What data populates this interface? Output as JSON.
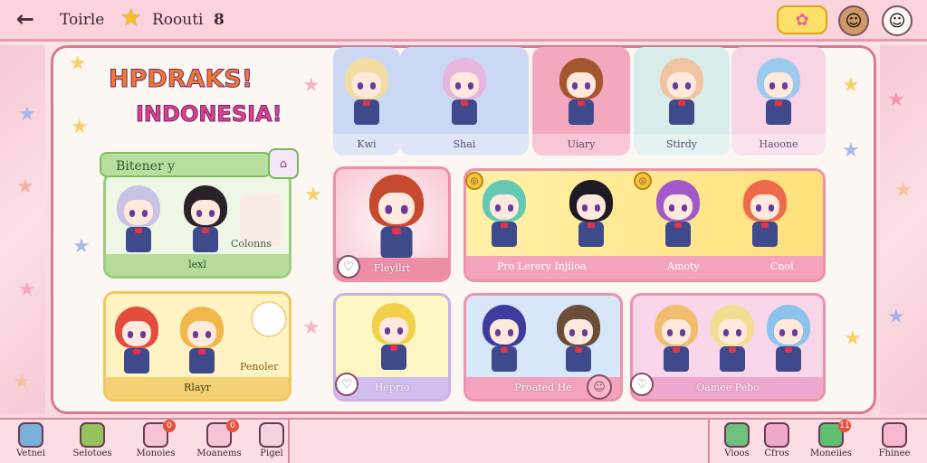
{
  "top_bar": {
    "back_label": "←",
    "tab1": "Toirle",
    "tab2": "Roouti",
    "tab2_badge": "8"
  },
  "logo": {
    "line1": "HPDRAKS!",
    "line2": "INDONESIA!"
  },
  "top_row": {
    "cards": [
      {
        "label": "Kwi",
        "hair": "#f3dca0",
        "bg": "#cbd8f3"
      },
      {
        "label": "Shai",
        "hair": "#e7b6dc",
        "bg": "#cbd8f3"
      },
      {
        "label": "Uiary",
        "hair": "#a5562e",
        "bg": "#f4a8bd"
      },
      {
        "label": "Stirdy",
        "hair": "#f1c3a0",
        "bg": "#d8ecec"
      },
      {
        "label": "Haoone",
        "hair": "#9cc9ee",
        "bg": "#f7d4e6"
      }
    ]
  },
  "group1": {
    "tag": "Bitener y",
    "label": "lexl",
    "side_label": "Colonns",
    "chars": [
      {
        "hair": "#c8c3e5"
      },
      {
        "hair": "#2a2228"
      }
    ]
  },
  "group2": {
    "label": "Rlayr",
    "side_label": "Penoler",
    "chars": [
      {
        "hair": "#e34b3b"
      },
      {
        "hair": "#f1b74a"
      }
    ]
  },
  "featured": {
    "label": "Fleyllrt",
    "hair": "#c84a2e"
  },
  "row2_group": {
    "label1": "Pro Lerery Injiloa",
    "label2": "Amoty",
    "label3": "Cnoi",
    "chars": [
      {
        "hair": "#66c7b2"
      },
      {
        "hair": "#1e1b22"
      },
      {
        "hair": "#a259c9"
      },
      {
        "hair": "#ee6a4b"
      }
    ]
  },
  "row3": {
    "card1_label": "Heprio",
    "card1_hair": "#f3d04a",
    "card2_label": "Proated He",
    "card2_chars": [
      {
        "hair": "#3d3b9e"
      },
      {
        "hair": "#6b4d3c"
      }
    ],
    "card3_label": "Oamee Pebo",
    "card3_chars": [
      {
        "hair": "#f0bd6c"
      },
      {
        "hair": "#f3dd90"
      },
      {
        "hair": "#8cc3ec"
      }
    ]
  },
  "bottom_nav": [
    {
      "label": "Vetnei",
      "icon": "pencil-icon",
      "color": "#7bb1d9"
    },
    {
      "label": "Selotoes",
      "icon": "cake-icon",
      "color": "#96c25a"
    },
    {
      "label": "Monoies",
      "icon": "mail-icon",
      "color": "#f6c4d6",
      "badge": "0"
    },
    {
      "label": "Moanems",
      "icon": "mail-icon",
      "color": "#f6c4d6",
      "badge": "0"
    },
    {
      "label": "Pigel",
      "icon": "chat-icon",
      "color": "#f4d3de"
    },
    {
      "label": "Vioos",
      "icon": "leaf-icon",
      "color": "#6fbf7d"
    },
    {
      "label": "Cfros",
      "icon": "face-icon",
      "color": "#f0a9c8"
    },
    {
      "label": "Moneiies",
      "icon": "leaf-icon",
      "color": "#5fbf6f",
      "badge": "11"
    },
    {
      "label": "Fhinee",
      "icon": "person-icon",
      "color": "#f6b7cf"
    }
  ]
}
